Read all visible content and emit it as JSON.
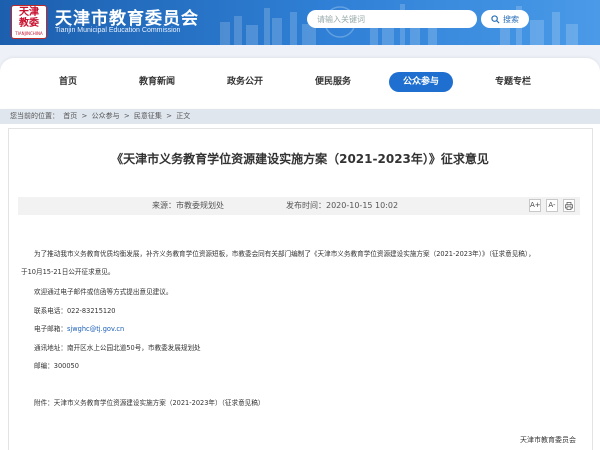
{
  "header": {
    "logo_glyph_line1": "天津",
    "logo_glyph_line2": "教委",
    "logo_caption": "TIANJINCHINA",
    "title": "天津市教育委员会",
    "subtitle": "Tianjin Municipal Education Commission",
    "search_placeholder": "请输入关键词",
    "search_button": "搜索",
    "colors": {
      "header_start": "#1c5fae",
      "header_end": "#4a9ae8",
      "logo_red": "#c8102e"
    }
  },
  "nav": {
    "items": [
      {
        "label": "首页"
      },
      {
        "label": "教育新闻"
      },
      {
        "label": "政务公开"
      },
      {
        "label": "便民服务"
      },
      {
        "label": "公众参与",
        "active": true
      },
      {
        "label": "专题专栏"
      }
    ],
    "active_color": "#1e6fd0"
  },
  "breadcrumb": {
    "prefix": "您当前的位置：",
    "items": [
      "首页",
      "公众参与",
      "民意征集",
      "正文"
    ],
    "separator": ">"
  },
  "article": {
    "title": "《天津市义务教育学位资源建设实施方案（2021-2023年）》征求意见",
    "source_label": "来源：",
    "source_value": "市教委规划处",
    "date_label": "发布时间：",
    "date_value": "2020-10-15 10:02",
    "tools": {
      "font_increase": "A+",
      "font_decrease": "A-",
      "print_icon": "print-icon"
    },
    "paragraph_1_line_1": "为了推动我市义务教育优质均衡发展，补齐义务教育学位资源短板，市教委会同有关部门编制了《天津市义务教育学位资源建设实施方案（2021-2023年）》（征求意见稿），",
    "paragraph_1_line_2": "于10月15-21日公开征求意见。",
    "paragraph_2": "欢迎通过电子邮件或信函等方式提出意见建议。",
    "phone_label": "联系电话：",
    "phone_value": "022-83215120",
    "email_label": "电子邮箱：",
    "email_value": "sjwghc@tj.gov.cn",
    "address_label": "通讯地址：",
    "address_value": "南开区水上公园北道50号，市教委发展规划处",
    "zip_label": "邮编：",
    "zip_value": "300050",
    "attachment_label": "附件：",
    "attachment_value": "天津市义务教育学位资源建设实施方案（2021-2023年）（征求意见稿）",
    "signature": "天津市教育委员会"
  }
}
